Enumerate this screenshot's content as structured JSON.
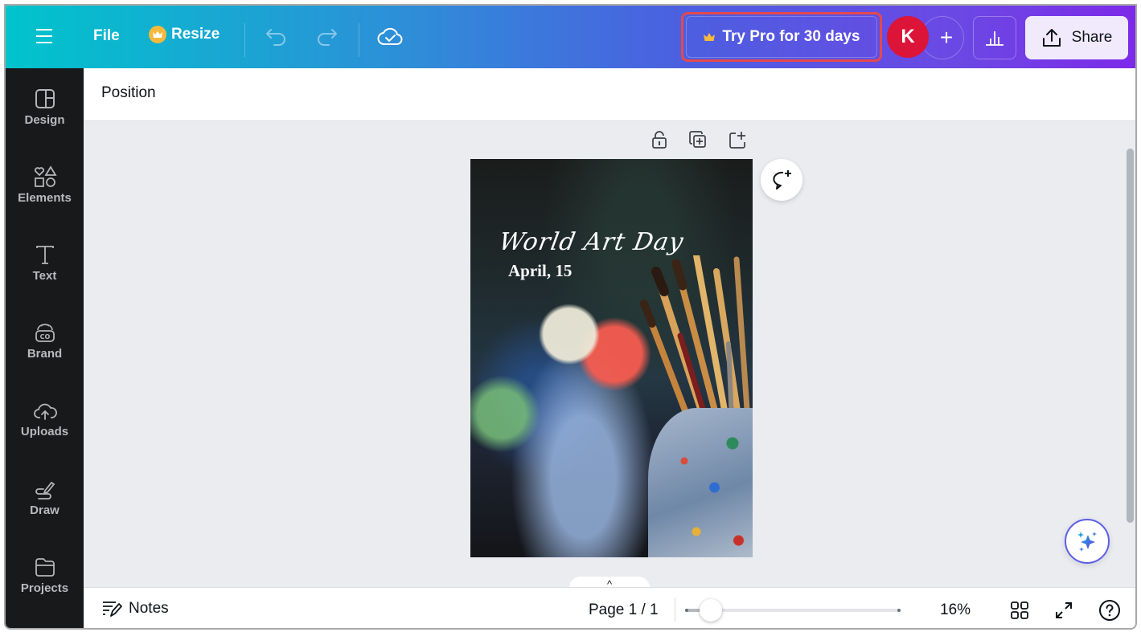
{
  "topbar": {
    "menu_icon": "hamburger-menu-icon",
    "file_label": "File",
    "resize_label": "Resize",
    "resize_icon": "crown-icon",
    "undo_icon": "undo-icon",
    "redo_icon": "redo-icon",
    "save_status_icon": "cloud-check-icon",
    "pro_label": "Try Pro for 30 days",
    "pro_icon": "crown-icon",
    "avatar_initial": "K",
    "avatar_color": "#dc1438",
    "add_collaborator_label": "+",
    "insights_icon": "bar-chart-icon",
    "share_label": "Share",
    "share_icon": "upload-share-icon"
  },
  "sidebar": {
    "items": [
      {
        "label": "Design",
        "icon": "layout-icon"
      },
      {
        "label": "Elements",
        "icon": "shapes-icon"
      },
      {
        "label": "Text",
        "icon": "text-icon"
      },
      {
        "label": "Brand",
        "icon": "brand-icon"
      },
      {
        "label": "Uploads",
        "icon": "cloud-upload-icon"
      },
      {
        "label": "Draw",
        "icon": "pen-icon"
      },
      {
        "label": "Projects",
        "icon": "folder-icon"
      }
    ]
  },
  "context_toolbar": {
    "position_label": "Position"
  },
  "canvas": {
    "page_tools": [
      "lock-icon",
      "duplicate-page-icon",
      "add-page-icon"
    ],
    "design": {
      "title": "World Art Day",
      "date": "April, 15"
    },
    "comment_icon": "add-comment-icon",
    "magic_icon": "sparkles-icon",
    "page_tab_icon": "^"
  },
  "bottombar": {
    "notes_label": "Notes",
    "page_indicator": "Page 1 / 1",
    "zoom_percent": 16,
    "zoom_label": "16%",
    "grid_view_icon": "grid-view-icon",
    "fullscreen_icon": "fullscreen-icon",
    "help_icon": "help-icon"
  }
}
